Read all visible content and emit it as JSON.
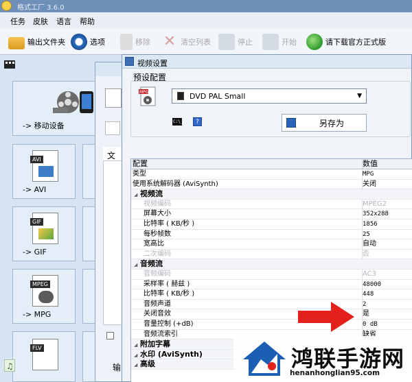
{
  "app": {
    "title": "格式工厂 3.6.0"
  },
  "menu": [
    "任务",
    "皮肤",
    "语言",
    "帮助"
  ],
  "toolbar": {
    "output_folder": "输出文件夹",
    "options": "选项",
    "delete": "移除",
    "clear": "清空列表",
    "stop": "停止",
    "start": "开始",
    "download": "请下载官方正式版"
  },
  "left_panel": {
    "tiles": [
      {
        "label": "-> 移动设备"
      },
      {
        "label": "-> AVI",
        "tag": "AVI"
      },
      {
        "label": "-> GIF",
        "tag": "GIF"
      },
      {
        "label": "-> MPG",
        "tag": "MPEG"
      },
      {
        "label": "",
        "tag": "FLV"
      }
    ]
  },
  "middle": {
    "file_column": "文件",
    "bottom_label": "输"
  },
  "dialog": {
    "title": "视频设置",
    "preset_label": "预设配置",
    "preset_value": "DVD PAL Small",
    "saveas": "另存为",
    "help": "?",
    "cmd": "C:\\_",
    "grid": {
      "header": {
        "key": "配置",
        "value": "数值"
      },
      "rows": [
        {
          "type": "item",
          "key": "类型",
          "value": "MPG",
          "mono": true
        },
        {
          "type": "item",
          "key": "使用系统解码器 (AviSynth)",
          "value": "关闭"
        },
        {
          "type": "cat",
          "key": "视频流",
          "value": ""
        },
        {
          "type": "sub-dis",
          "key": "视频编码",
          "value": "MPEG2"
        },
        {
          "type": "sub",
          "key": "屏幕大小",
          "value": "352x288",
          "mono": true
        },
        {
          "type": "sub",
          "key": "比特率 ( KB/秒 )",
          "value": "1856",
          "mono": true
        },
        {
          "type": "sub",
          "key": "每秒帧数",
          "value": "25",
          "mono": true
        },
        {
          "type": "sub",
          "key": "宽高比",
          "value": "自动"
        },
        {
          "type": "sub-dis",
          "key": "二次编码",
          "value": "否"
        },
        {
          "type": "cat",
          "key": "音频流",
          "value": ""
        },
        {
          "type": "sub-dis",
          "key": "音频编码",
          "value": "AC3"
        },
        {
          "type": "sub",
          "key": "采样率 ( 赫兹 )",
          "value": "48000",
          "mono": true
        },
        {
          "type": "sub",
          "key": "比特率 ( KB/秒 )",
          "value": "448",
          "mono": true
        },
        {
          "type": "sub",
          "key": "音频声道",
          "value": "2",
          "mono": true
        },
        {
          "type": "sub",
          "key": "关闭音效",
          "value": "是"
        },
        {
          "type": "sub",
          "key": "音量控制 (+dB)",
          "value": "0 dB",
          "mono": true
        },
        {
          "type": "sub",
          "key": "音频流索引",
          "value": "缺省"
        },
        {
          "type": "cat",
          "key": "附加字幕",
          "value": ""
        },
        {
          "type": "cat",
          "key": "水印 (AviSynth)",
          "value": ""
        },
        {
          "type": "cat",
          "key": "高级",
          "value": ""
        }
      ]
    }
  },
  "watermark": {
    "text": "鸿联手游网",
    "url": "henanhonglian95.com"
  },
  "colors": {
    "arrow": "#e3201b",
    "toolbar_bg": "#f2f5f9",
    "sidebar_bg": "#d6e4f3"
  }
}
